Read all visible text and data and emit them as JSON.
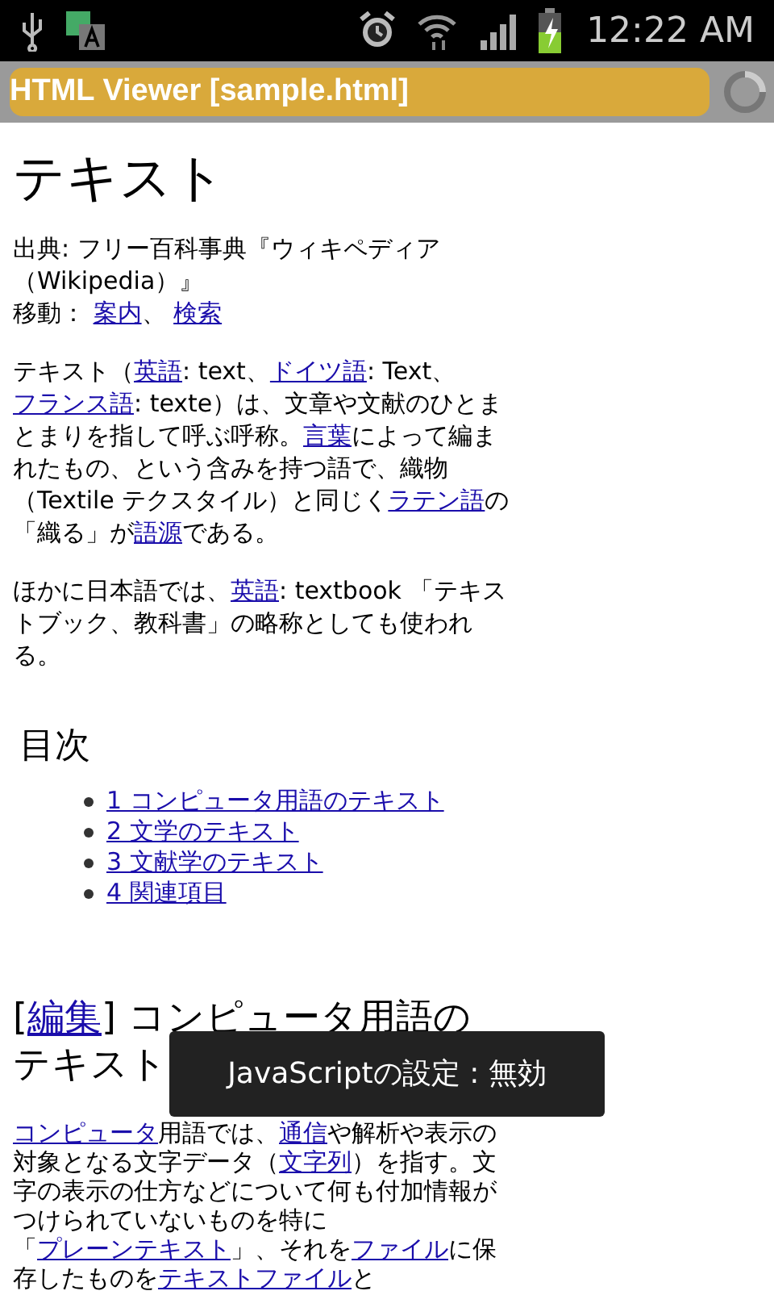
{
  "status_bar": {
    "time": "12:22 AM"
  },
  "title_bar": {
    "title": "HTML Viewer [sample.html]",
    "loading": true
  },
  "article": {
    "title": "テキスト",
    "source": [
      {
        "text": "出典: フリー百科事典『ウィキペディア（Wikipedia）』",
        "link": false
      }
    ],
    "navigation": [
      {
        "text": "移動： ",
        "link": false
      },
      {
        "text": "案内",
        "link": true
      },
      {
        "text": "、 ",
        "link": false
      },
      {
        "text": "検索",
        "link": true
      }
    ],
    "paragraphs": [
      [
        {
          "text": "テキスト（",
          "link": false
        },
        {
          "text": "英語",
          "link": true
        },
        {
          "text": ": text、",
          "link": false
        },
        {
          "text": "ドイツ語",
          "link": true
        },
        {
          "text": ": Text、",
          "link": false
        },
        {
          "text": "フランス語",
          "link": true
        },
        {
          "text": ": texte）は、文章や文献のひとまとまりを指して呼ぶ呼称。",
          "link": false
        },
        {
          "text": "言葉",
          "link": true
        },
        {
          "text": "によって編まれたもの、という含みを持つ語で、織物（Textile テクスタイル）と同じく",
          "link": false
        },
        {
          "text": "ラテン語",
          "link": true
        },
        {
          "text": "の「織る」が",
          "link": false
        },
        {
          "text": "語源",
          "link": true
        },
        {
          "text": "である。",
          "link": false
        }
      ],
      [
        {
          "text": "ほかに日本語では、",
          "link": false
        },
        {
          "text": "英語",
          "link": true
        },
        {
          "text": ": textbook 「テキストブック、教科書」の略称としても使われる。",
          "link": false
        }
      ]
    ],
    "toc": {
      "title": "目次",
      "items": [
        "1 コンピュータ用語のテキスト",
        "2 文学のテキスト",
        "3 文献学のテキスト",
        "4 関連項目"
      ]
    },
    "section": {
      "heading": [
        {
          "text": "[",
          "link": false
        },
        {
          "text": "編集",
          "link": true
        },
        {
          "text": "] コンピュータ用語のテキスト",
          "link": false
        }
      ],
      "paragraph": [
        {
          "text": "コンピュータ",
          "link": true
        },
        {
          "text": "用語では、",
          "link": false
        },
        {
          "text": "通信",
          "link": true
        },
        {
          "text": "や解析や表示の対象となる文字データ（",
          "link": false
        },
        {
          "text": "文字列",
          "link": true
        },
        {
          "text": "）を指す。文字の表示の仕方などについて何も付加情報がつけられていないものを特に「",
          "link": false
        },
        {
          "text": "プレーンテキスト",
          "link": true
        },
        {
          "text": "」、それを",
          "link": false
        },
        {
          "text": "ファイル",
          "link": true
        },
        {
          "text": "に保存したものを",
          "link": false
        },
        {
          "text": "テキストファイル",
          "link": true
        },
        {
          "text": "と",
          "link": false
        }
      ]
    }
  },
  "toast": {
    "text": "JavaScriptの設定 : 無効"
  }
}
